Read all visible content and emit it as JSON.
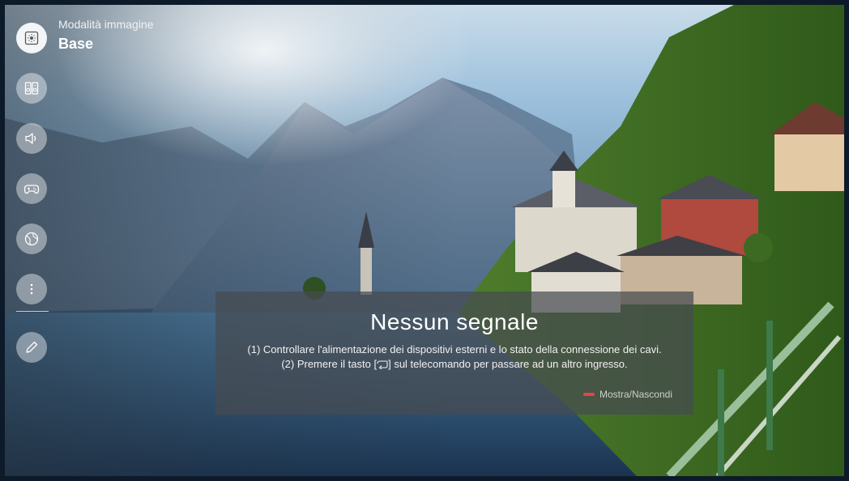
{
  "picture_mode": {
    "label": "Modalità immagine",
    "value": "Base"
  },
  "side_menu": {
    "items": [
      {
        "icon": "picture-mode-icon",
        "active": true
      },
      {
        "icon": "speakers-icon"
      },
      {
        "icon": "volume-icon"
      },
      {
        "icon": "game-controller-icon"
      },
      {
        "icon": "globe-icon"
      },
      {
        "icon": "more-options-icon"
      },
      {
        "icon": "edit-pencil-icon"
      }
    ]
  },
  "no_signal": {
    "title": "Nessun segnale",
    "line1": "(1) Controllare l'alimentazione dei dispositivi esterni e lo stato della connessione dei cavi.",
    "line2_before": "(2) Premere il tasto [",
    "line2_after": "] sul telecomando per passare ad un altro ingresso.",
    "toggle_label": "Mostra/Nascondi",
    "toggle_key_color": "#e6424f"
  }
}
